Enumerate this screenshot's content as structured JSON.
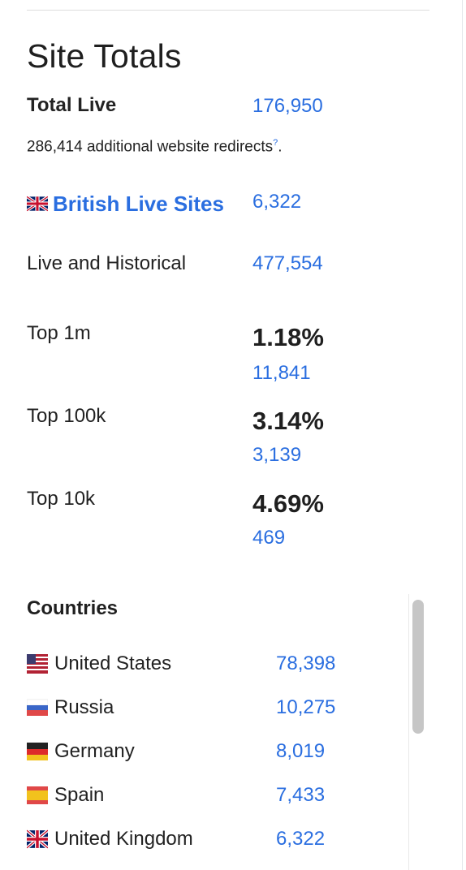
{
  "site_totals": {
    "title": "Site Totals",
    "total_live_label": "Total Live",
    "total_live_value": "176,950",
    "redirects_text": "286,414 additional website redirects",
    "redirects_help": "?",
    "redirects_suffix": ".",
    "british_live_label": "British Live Sites",
    "british_live_value": "6,322",
    "live_hist_label": "Live and Historical",
    "live_hist_value": "477,554"
  },
  "tops": [
    {
      "label": "Top 1m",
      "percent": "1.18%",
      "count": "11,841"
    },
    {
      "label": "Top 100k",
      "percent": "3.14%",
      "count": "3,139"
    },
    {
      "label": "Top 10k",
      "percent": "4.69%",
      "count": "469"
    }
  ],
  "countries": {
    "title": "Countries",
    "items": [
      {
        "name": "United States",
        "value": "78,398",
        "flag_icon": "us-flag-icon"
      },
      {
        "name": "Russia",
        "value": "10,275",
        "flag_icon": "russia-flag-icon"
      },
      {
        "name": "Germany",
        "value": "8,019",
        "flag_icon": "germany-flag-icon"
      },
      {
        "name": "Spain",
        "value": "7,433",
        "flag_icon": "spain-flag-icon"
      },
      {
        "name": "United Kingdom",
        "value": "6,322",
        "flag_icon": "uk-flag-icon"
      }
    ]
  },
  "colors": {
    "link": "#2a6ee0",
    "text": "#222222",
    "scroll_thumb": "#c6c6c6"
  }
}
